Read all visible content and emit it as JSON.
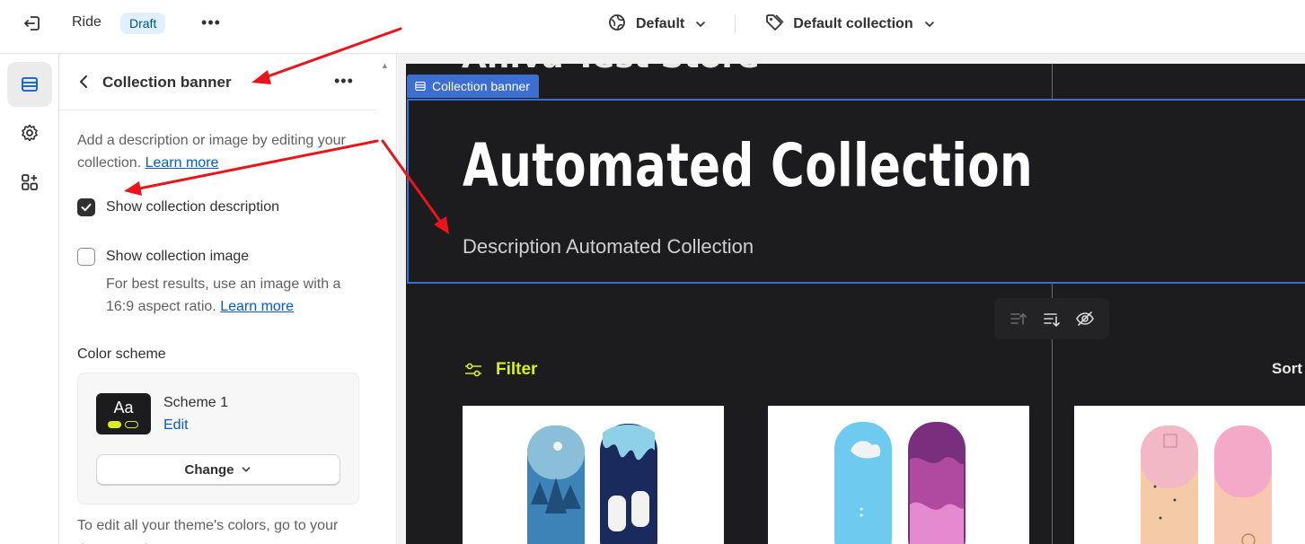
{
  "topbar": {
    "theme_name": "Ride",
    "status_badge": "Draft",
    "more_label": "•••",
    "preset": "Default",
    "template": "Default collection"
  },
  "panel": {
    "title": "Collection banner",
    "more_label": "•••",
    "description_text": "Add a description or image by editing your collection.",
    "learn_more": "Learn more",
    "show_description": {
      "label": "Show collection description",
      "checked": true
    },
    "show_image": {
      "label": "Show collection image",
      "checked": false
    },
    "image_hint": "For best results, use an image with a 16:9 aspect ratio.",
    "image_hint_link": "Learn more",
    "color_scheme_label": "Color scheme",
    "scheme": {
      "swatch_text": "Aa",
      "name": "Scheme 1",
      "edit": "Edit",
      "change": "Change"
    },
    "footer_text": "To edit all your theme's colors, go to your theme settings."
  },
  "preview": {
    "store_name": "Ahiva Test Store",
    "section_tag": "Collection banner",
    "banner_title": "Automated Collection",
    "banner_description": "Description Automated Collection",
    "filter_label": "Filter",
    "sort_label": "Sort"
  },
  "colors": {
    "accent": "#d9ef1c",
    "selection": "#3b6fd1",
    "store_bg": "#1c1c1e",
    "annotation_arrow": "#e8161b"
  }
}
